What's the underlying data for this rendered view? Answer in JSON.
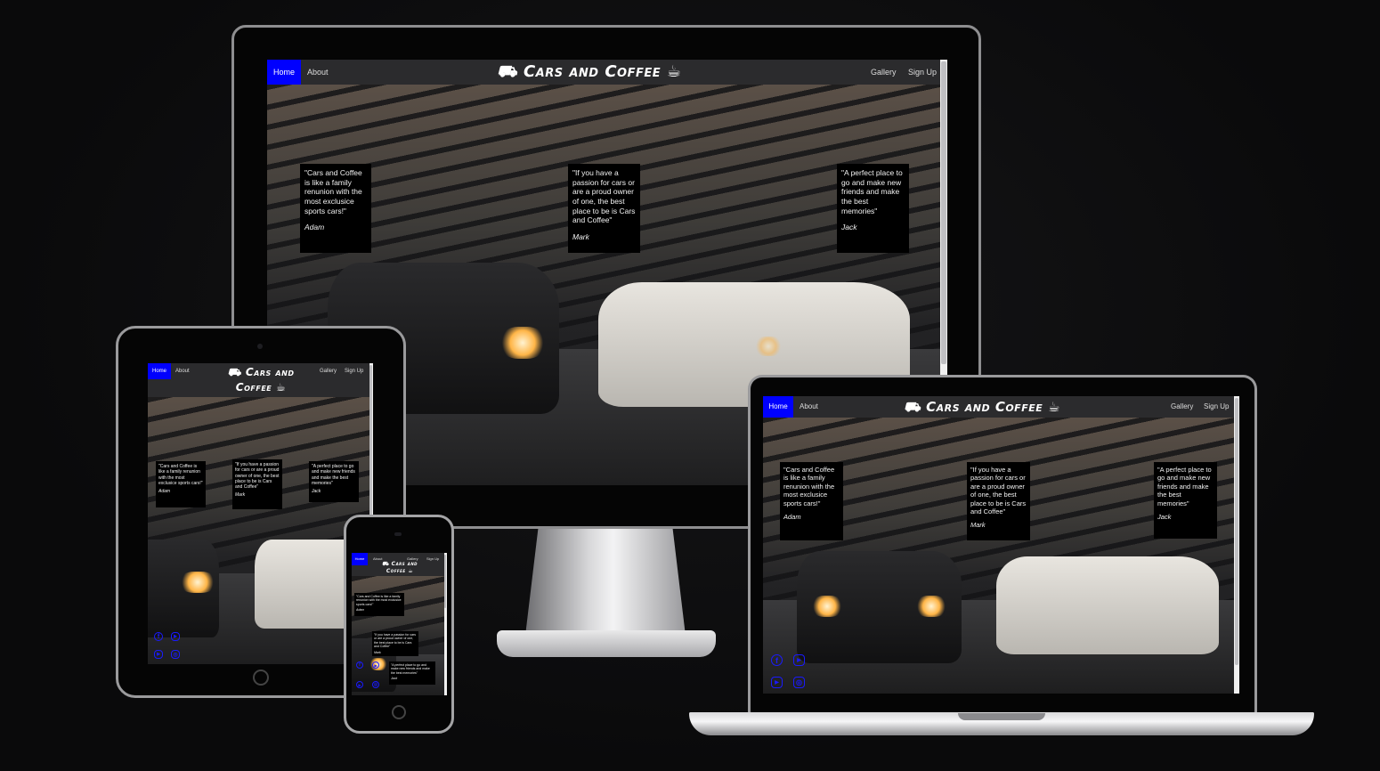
{
  "site": {
    "brand": "Cars and Coffee",
    "brand_icons": {
      "left": "car-icon",
      "right": "coffee-cup-icon"
    },
    "accent_color": "#0000ff",
    "nav": {
      "home": "Home",
      "about": "About",
      "gallery": "Gallery",
      "signup": "Sign Up"
    },
    "quotes": [
      {
        "text": "\"Cars and Coffee is like a family renunion with the most exclusice sports cars!\"",
        "author": "Adam"
      },
      {
        "text": "\"If you have a passion for cars or are a proud owner of one, the best place to be is Cars and Coffee\"",
        "author": "Mark"
      },
      {
        "text": "\"A perfect place to go and make new friends and make the best memories\"",
        "author": "Jack"
      }
    ],
    "social_icons": [
      "facebook-icon",
      "youtube-icon",
      "youtube-icon",
      "instagram-icon"
    ]
  },
  "glyphs": {
    "car": "⛟",
    "coffee": "☕",
    "facebook": "f",
    "youtube": "▶",
    "instagram": "◎"
  }
}
